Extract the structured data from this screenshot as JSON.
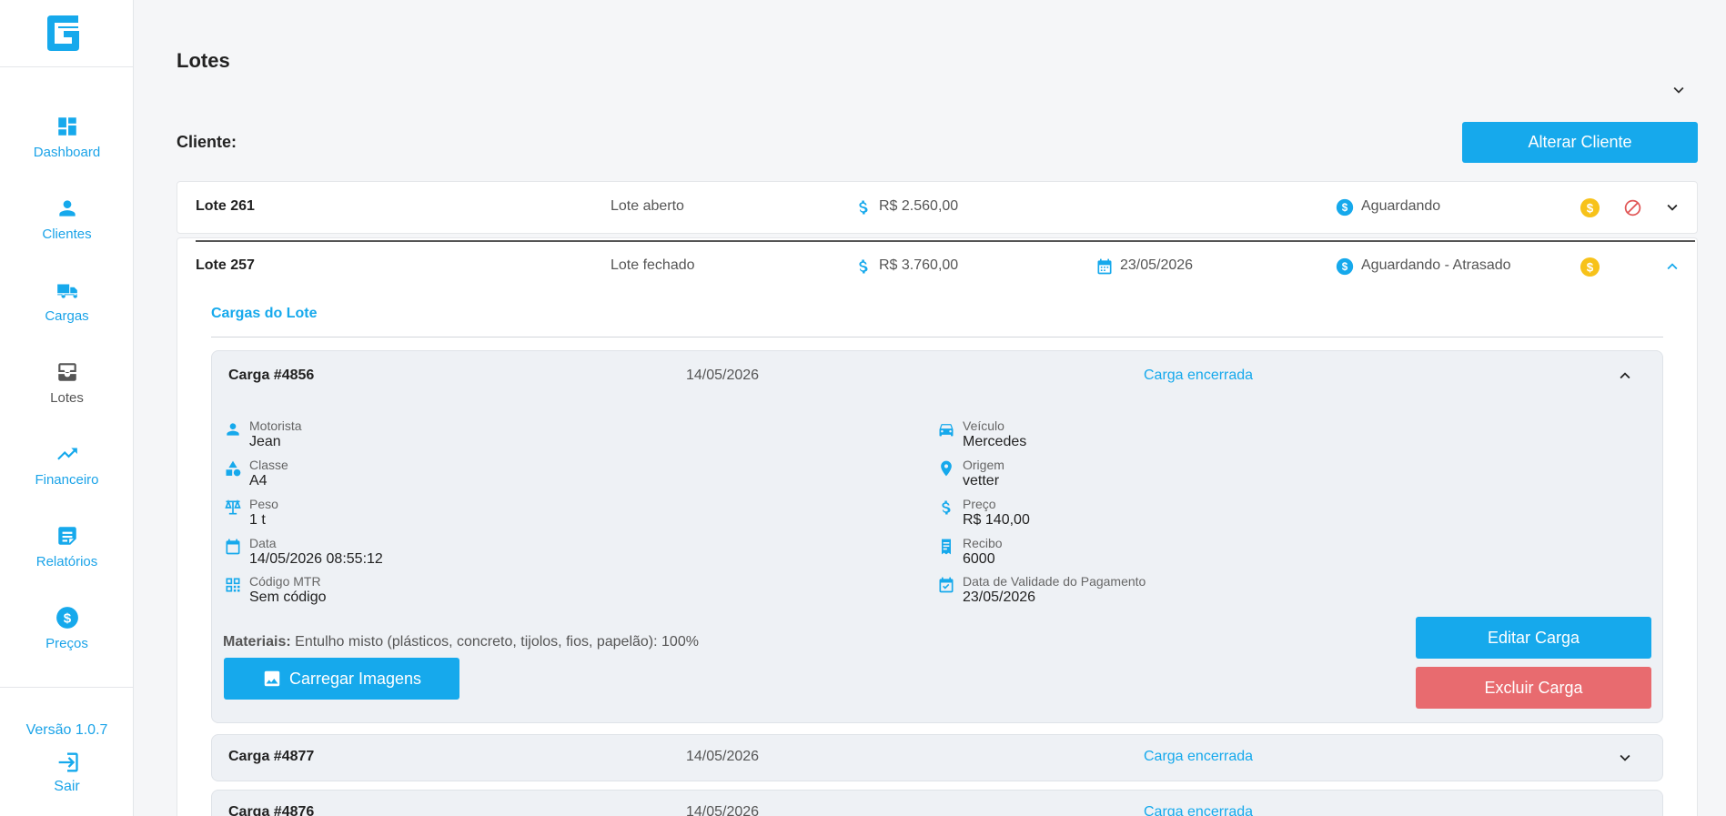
{
  "sidebar": {
    "items": [
      {
        "label": "Dashboard",
        "icon": "dashboard-icon"
      },
      {
        "label": "Clientes",
        "icon": "person-icon"
      },
      {
        "label": "Cargas",
        "icon": "truck-icon"
      },
      {
        "label": "Lotes",
        "icon": "inbox-icon"
      },
      {
        "label": "Financeiro",
        "icon": "trending-up-icon"
      },
      {
        "label": "Relatórios",
        "icon": "report-icon"
      },
      {
        "label": "Preços",
        "icon": "dollar-circle-icon"
      }
    ],
    "version": "Versão 1.0.7",
    "logout": "Sair"
  },
  "page": {
    "title": "Lotes",
    "client_label": "Cliente:",
    "change_client_button": "Alterar Cliente"
  },
  "lotes": [
    {
      "name": "Lote 261",
      "status": "Lote aberto",
      "value": "R$ 2.560,00",
      "date": "",
      "payment": "Aguardando"
    },
    {
      "name": "Lote 257",
      "status": "Lote fechado",
      "value": "R$ 3.760,00",
      "date": "23/05/2026",
      "payment": "Aguardando - Atrasado"
    }
  ],
  "cargas_section": {
    "title": "Cargas do Lote"
  },
  "carga_expanded": {
    "title": "Carga #4856",
    "date": "14/05/2026",
    "status": "Carga encerrada",
    "left_fields": [
      {
        "label": "Motorista",
        "value": "Jean",
        "icon": "person-icon"
      },
      {
        "label": "Classe",
        "value": "A4",
        "icon": "category-icon"
      },
      {
        "label": "Peso",
        "value": "1 t",
        "icon": "scale-icon"
      },
      {
        "label": "Data",
        "value": "14/05/2026 08:55:12",
        "icon": "calendar-icon"
      },
      {
        "label": "Código MTR",
        "value": "Sem código",
        "icon": "qr-code-icon"
      }
    ],
    "right_fields": [
      {
        "label": "Veículo",
        "value": "Mercedes",
        "icon": "car-icon"
      },
      {
        "label": "Origem",
        "value": "vetter",
        "icon": "location-pin-icon"
      },
      {
        "label": "Preço",
        "value": "R$ 140,00",
        "icon": "dollar-icon"
      },
      {
        "label": "Recibo",
        "value": "6000",
        "icon": "receipt-icon"
      },
      {
        "label": "Data de Validade do Pagamento",
        "value": "23/05/2026",
        "icon": "event-check-icon"
      }
    ],
    "materials_label": "Materiais:",
    "materials_value": "Entulho misto (plásticos, concreto, tijolos, fios, papelão): 100%",
    "upload_button": "Carregar Imagens",
    "edit_button": "Editar Carga",
    "delete_button": "Excluir Carga"
  },
  "cargas_collapsed": [
    {
      "title": "Carga #4877",
      "date": "14/05/2026",
      "status": "Carga encerrada"
    },
    {
      "title": "Carga #4876",
      "date": "14/05/2026",
      "status": "Carga encerrada"
    }
  ],
  "colors": {
    "accent": "#16a9ec",
    "danger": "#e86b6f",
    "coin": "#f7c21a",
    "cancel": "#e05555"
  }
}
